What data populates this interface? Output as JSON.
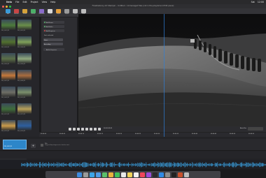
{
  "menubar": {
    "apple": "",
    "items": [
      "Nelo",
      "File",
      "Edit",
      "Project",
      "View",
      "Help"
    ],
    "right": [
      "Sat",
      "12:00"
    ]
  },
  "window": {
    "title": "Flowblade by Art Stamper – Untitled – Unmanaged files (not in the playlist and Edit panel)"
  },
  "toolbar": {
    "buttons": [
      {
        "label": "Add",
        "color": "#3a9bd9"
      },
      {
        "label": "Remove",
        "color": "#c84646"
      },
      {
        "label": "Media",
        "color": "#d6a23a"
      },
      {
        "label": "Effects",
        "color": "#4caf68"
      },
      {
        "label": "Transitions",
        "color": "#8a6cc9"
      },
      {
        "label": "Titles",
        "color": "#d8d8d8"
      },
      {
        "label": "Import",
        "color": "#e6a03a"
      },
      {
        "label": "Export",
        "color": "#9b9b9b"
      },
      {
        "label": "Undo",
        "color": "#bdbdbd"
      },
      {
        "label": "Redo",
        "color": "#bdbdbd"
      }
    ]
  },
  "files": {
    "items": [
      {
        "name": "IMG_0001.JPG",
        "color": "#4d7a3c"
      },
      {
        "name": "IMG_0002.JPG",
        "color": "#6b8f4a"
      },
      {
        "name": "IMG_0003.JPG",
        "color": "#52702f"
      },
      {
        "name": "IMG_0004.JPG",
        "color": "#7fa05a"
      },
      {
        "name": "IMG_0005.JPG",
        "color": "#5b6f48"
      },
      {
        "name": "IMG_0006.JPG",
        "color": "#8fa77e"
      },
      {
        "name": "IMG_0007.JPG",
        "color": "#c4783a"
      },
      {
        "name": "IMG_0008.JPG",
        "color": "#a86c3e"
      },
      {
        "name": "IMG_0009.JPG",
        "color": "#6e6e66"
      },
      {
        "name": "IMG_0010.JPG",
        "color": "#7b8f6c"
      },
      {
        "name": "IMG_0011.JPG",
        "color": "#3f6d3a"
      },
      {
        "name": "IMG_0012.JPG",
        "color": "#b8a15a"
      },
      {
        "name": "IMG_0013.JPG",
        "color": "#c89a4a"
      },
      {
        "name": "IMG_0014.JPG",
        "color": "#2e5f9e"
      }
    ]
  },
  "panel": {
    "items": [
      {
        "label": "Add Source",
        "color": "#57b36a"
      },
      {
        "label": "Add Folder",
        "color": "#57b36a"
      },
      {
        "label": "Add Sequence",
        "color": "#c84646"
      }
    ],
    "section_label": "Sort selected",
    "fields": [
      "Name",
      "Ascending"
    ],
    "action": "Add to Sequence"
  },
  "controls": {
    "timecode": "00:00:00:00",
    "right_label": "Auto-Pan"
  },
  "ruler": {
    "ticks": [
      "00:00:00",
      "00:00:05",
      "00:00:10",
      "00:00:15",
      "00:00:20",
      "00:00:25",
      "00:00:30",
      "00:00:35",
      "00:00:40",
      "00:00:45",
      "00:00:50",
      "00:00:55"
    ]
  },
  "timeline": {
    "clip_label": "IMG_0001.JPG",
    "track_note": "Title",
    "track_note2": "Drag and drop images onto a timeline track"
  },
  "colors": {
    "accent": "#2f7fd8",
    "clip": "#2d86c9",
    "wave": "#3aa6e8"
  },
  "dock": {
    "apps": [
      {
        "name": "finder",
        "color": "#3c8be0"
      },
      {
        "name": "launchpad",
        "color": "#9a9a9a"
      },
      {
        "name": "safari",
        "color": "#3aa4e8"
      },
      {
        "name": "mail",
        "color": "#4e9be6"
      },
      {
        "name": "maps",
        "color": "#5bbf6a"
      },
      {
        "name": "photos",
        "color": "#e8b23c"
      },
      {
        "name": "facetime",
        "color": "#3fbf5a"
      },
      {
        "name": "calendar",
        "color": "#e9e9e9"
      },
      {
        "name": "notes",
        "color": "#f0d35a"
      },
      {
        "name": "reminders",
        "color": "#f0f0f0"
      },
      {
        "name": "music",
        "color": "#f0465a"
      },
      {
        "name": "podcasts",
        "color": "#9b4bd9"
      },
      {
        "name": "tv",
        "color": "#2b2b2b"
      },
      {
        "name": "appstore",
        "color": "#2f8ae6"
      },
      {
        "name": "settings",
        "color": "#8c8c8c"
      },
      {
        "name": "terminal",
        "color": "#222"
      },
      {
        "name": "editor",
        "color": "#c8502c"
      },
      {
        "name": "trash",
        "color": "#bcbcbc"
      }
    ]
  }
}
